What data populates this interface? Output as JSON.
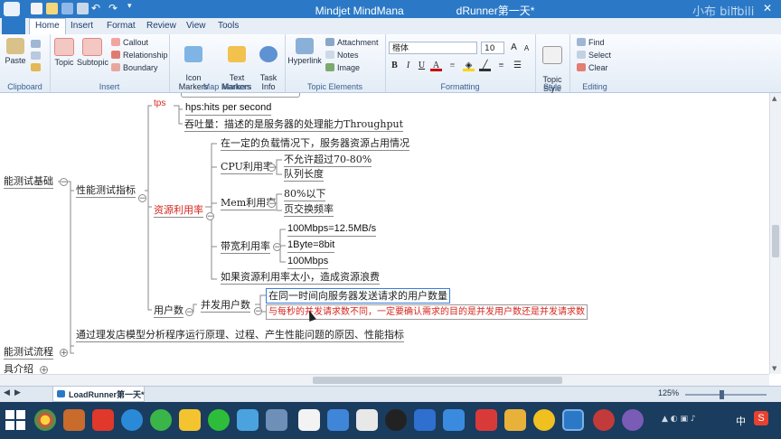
{
  "window": {
    "title": "Mindjet MindManager - LoadRunner第一天*",
    "title_left": "Mindjet MindMana",
    "title_right": "dRunner第一天*",
    "watermark": "小布 bilibili"
  },
  "ribbon": {
    "tabs": [
      "Home",
      "Insert",
      "Format",
      "Review",
      "View",
      "Tools"
    ],
    "active_tab": "Home",
    "clipboard": {
      "paste": "Paste",
      "label": "Clipboard"
    },
    "insert": {
      "topic": "Topic",
      "subtopic": "Subtopic",
      "callout": "Callout",
      "relationship": "Relationship",
      "boundary": "Boundary",
      "label": "Insert"
    },
    "map_markers": {
      "icon_markers": "Icon\nMarkers",
      "text_markers": "Text\nMarkers",
      "task_info": "Task\nInfo",
      "label": "Map Markers"
    },
    "topic_elements": {
      "hyperlink": "Hyperlink",
      "attachment": "Attachment",
      "notes": "Notes",
      "image": "Image",
      "label": "Topic Elements"
    },
    "formatting": {
      "font": "楷体",
      "size": "10",
      "label": "Formatting"
    },
    "style": {
      "topic_style": "Topic\nStyle",
      "label": "Style"
    },
    "editing": {
      "find": "Find",
      "select": "Select",
      "clear": "Clear",
      "label": "Editing"
    }
  },
  "map": {
    "left_cut_topic": "能测试基础",
    "metrics_topic": "性能测试指标",
    "tps_label": "tps",
    "hps": "hps:hits per second",
    "throughput": "吞吐量：描述的是服务器的处理能力Throughput",
    "resource_topic": "资源利用率",
    "load_desc": "在一定的负载情况下，服务器资源占用情况",
    "cpu": "CPU利用率",
    "cpu_limit": "不允许超过70-80%",
    "cpu_queue": "队列长度",
    "mem": "Mem利用率",
    "mem_limit": "80%以下",
    "mem_swap": "页交换频率",
    "bandwidth": "带宽利用率",
    "bw_1": "100Mbps=12.5MB/s",
    "bw_2": "1Byte=8bit",
    "bw_3": "100Mbps",
    "waste": "如果资源利用率太小，造成资源浪费",
    "users": "用户数",
    "concurrent": "并发用户数",
    "concurrent_def": "在同一时间向服务器发送请求的用户数量",
    "concurrent_note": "与每秒的并发请求数不同，一定要确认需求的目的是并发用户数还是并发请求数",
    "analysis": "通过理发店模型分析程序运行原理、过程、产生性能问题的原因、性能指标",
    "flow": "能测试流程",
    "intro": "具介绍"
  },
  "status": {
    "doc_tab": "LoadRunner第一天*",
    "zoom": "125%"
  },
  "taskbar": {
    "lang": "中",
    "ime": "S"
  }
}
